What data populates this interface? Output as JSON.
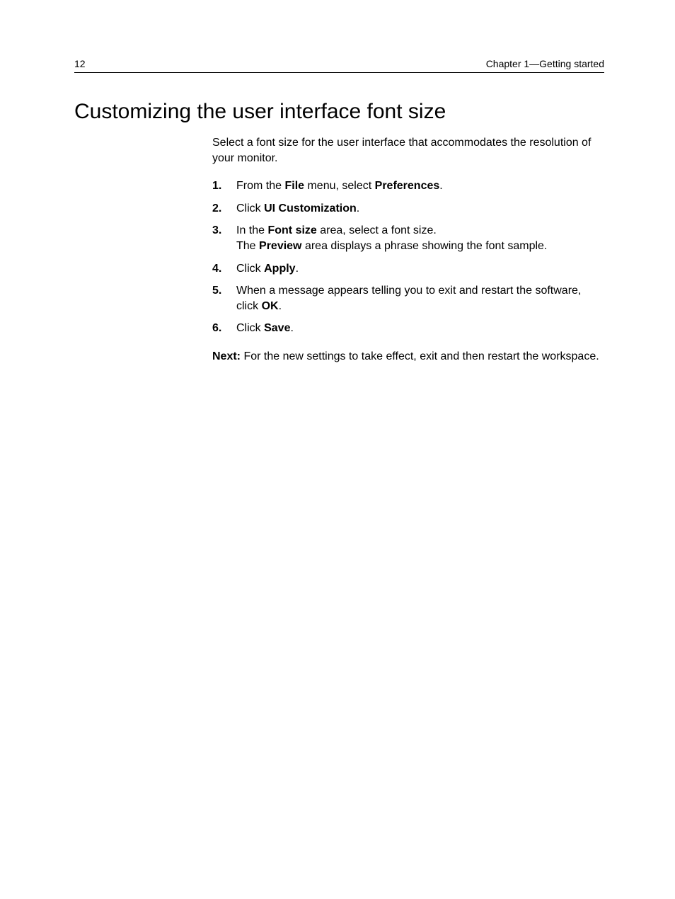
{
  "header": {
    "page_number": "12",
    "chapter_label": "Chapter 1—Getting started"
  },
  "section": {
    "title": "Customizing the user interface font size",
    "intro": "Select a font size for the user interface that accommodates the resolution of your monitor."
  },
  "steps": [
    {
      "pre1": "From the ",
      "b1": "File",
      "mid1": " menu, select ",
      "b2": "Preferences",
      "post1": "."
    },
    {
      "pre1": "Click ",
      "b1": "UI Customization",
      "post1": "."
    },
    {
      "pre1": "In the ",
      "b1": "Font size",
      "post1": " area, select a font size.",
      "follow_pre": "The ",
      "follow_b": "Preview",
      "follow_post": " area displays a phrase showing the font sample."
    },
    {
      "pre1": "Click ",
      "b1": "Apply",
      "post1": "."
    },
    {
      "pre1": "When a message appears telling you to exit and restart the software, click ",
      "b1": "OK",
      "post1": "."
    },
    {
      "pre1": "Click ",
      "b1": "Save",
      "post1": "."
    }
  ],
  "next": {
    "label": "Next:",
    "text": " For the new settings to take effect, exit and then restart the workspace."
  }
}
